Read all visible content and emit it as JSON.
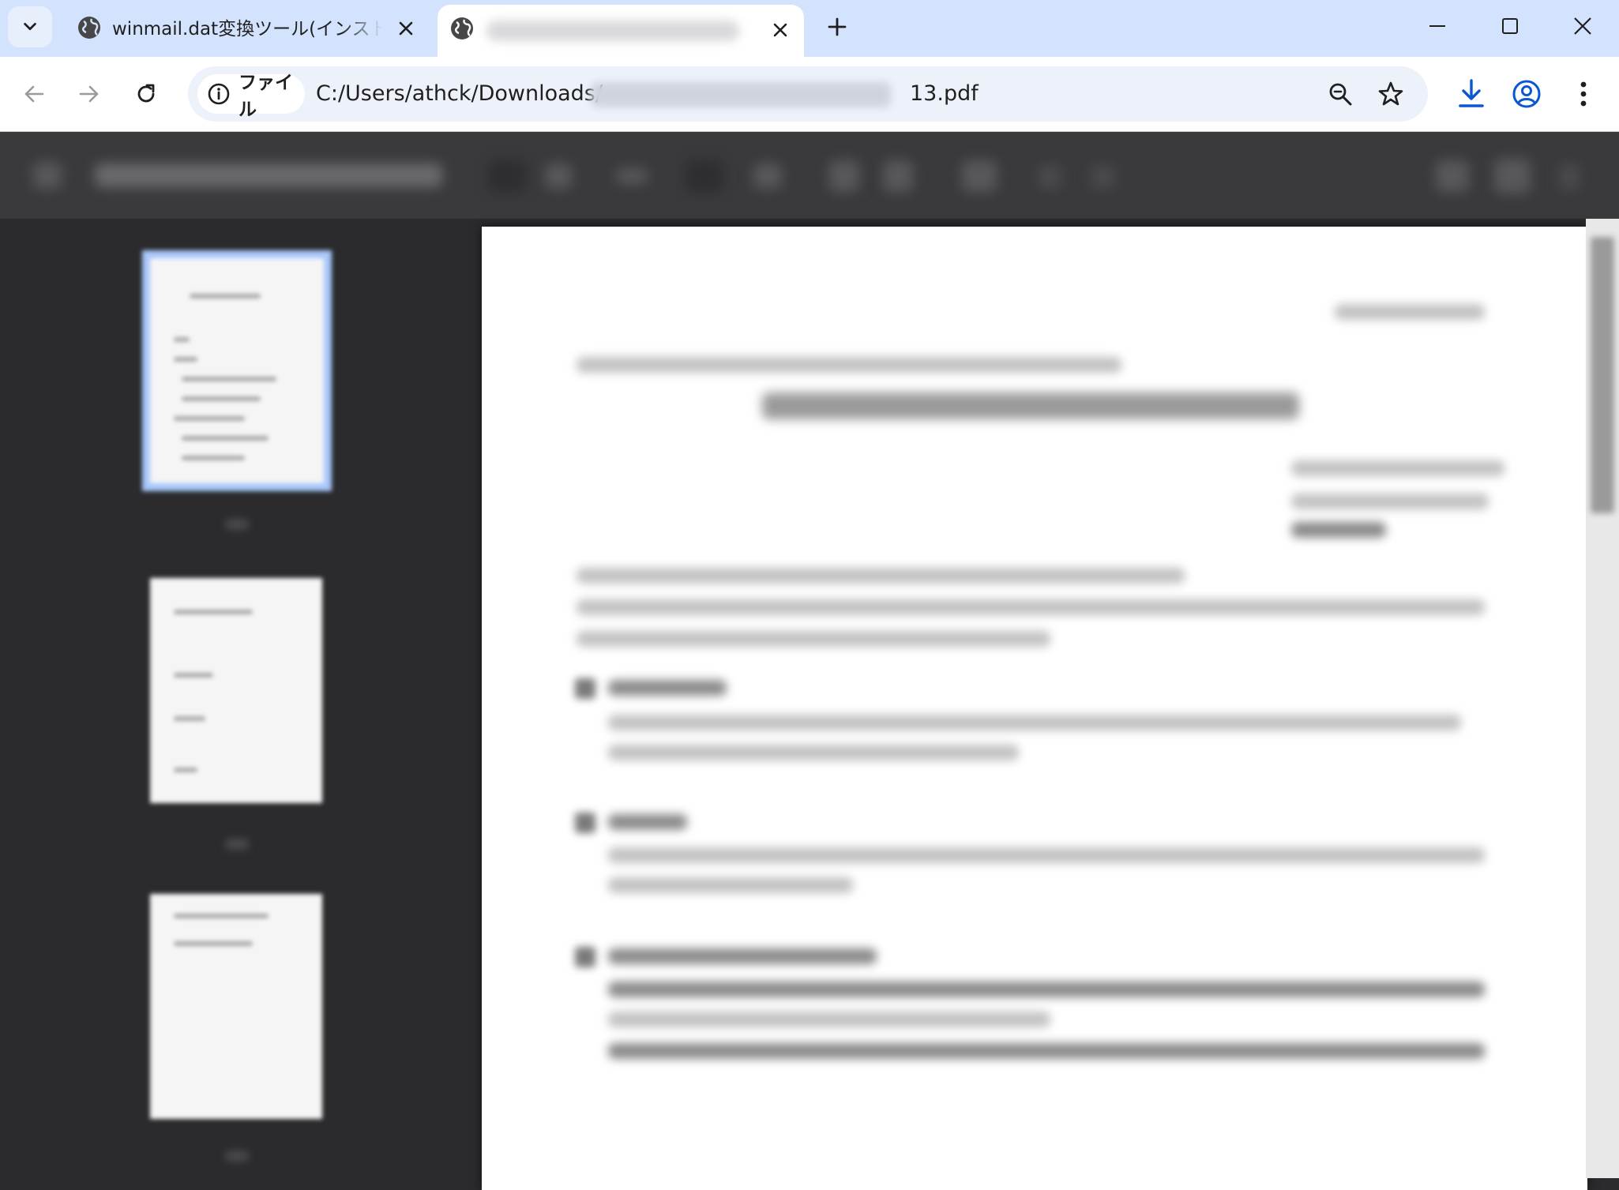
{
  "tabs": [
    {
      "title": "winmail.dat変換ツール(インストール不要)",
      "active": false
    },
    {
      "title": "",
      "active": true
    }
  ],
  "omnibox": {
    "scheme_chip": "ファイル",
    "url_prefix": "C:/Users/athck/Downloads/",
    "url_suffix": "13.pdf"
  },
  "colors": {
    "tabstrip": "#d3e3fd",
    "accent": "#0b57d0",
    "pdf_background": "#2b2b2e",
    "pdf_toolbar": "#3a3a3c",
    "thumbnail_selected_ring": "#a8c7fa"
  },
  "pdf": {
    "thumbnails": 3,
    "selected_page": 1
  },
  "icons": {
    "tab_search": "chevron-down-icon",
    "favicon": "globe-icon",
    "close": "close-icon",
    "new_tab": "plus-icon",
    "minimize": "minimize-icon",
    "maximize": "maximize-icon",
    "window_close": "close-icon",
    "back": "arrow-left-icon",
    "forward": "arrow-right-icon",
    "reload": "reload-icon",
    "site_info": "info-icon",
    "zoom": "zoom-icon",
    "bookmark": "star-icon",
    "downloads": "download-icon",
    "profile": "profile-icon",
    "menu": "kebab-menu-icon"
  }
}
